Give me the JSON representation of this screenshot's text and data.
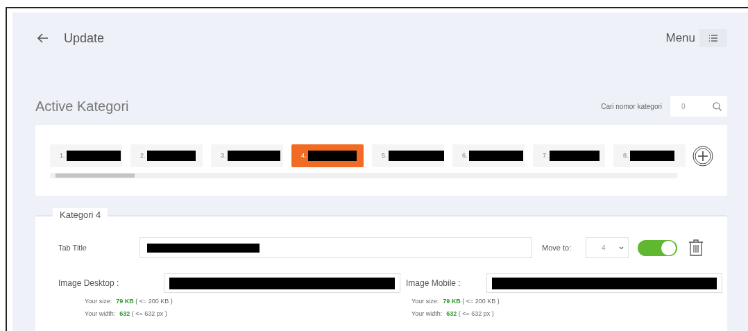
{
  "header": {
    "title": "Update",
    "menu_label": "Menu"
  },
  "section_title": "Active Kategori",
  "search": {
    "label": "Cari nomor kategori",
    "value": "0"
  },
  "category_tabs": [
    {
      "number": "1.",
      "selected": false
    },
    {
      "number": "2.",
      "selected": false
    },
    {
      "number": "3.",
      "selected": false
    },
    {
      "number": "4.",
      "selected": true
    },
    {
      "number": "5.",
      "selected": false
    },
    {
      "number": "6.",
      "selected": false
    },
    {
      "number": "7.",
      "selected": false
    },
    {
      "number": "8.",
      "selected": false
    }
  ],
  "kategori_panel": {
    "legend": "Kategori 4",
    "tab_title_label": "Tab Title",
    "move_to_label": "Move to:",
    "move_to_value": "4",
    "on": true,
    "images": [
      {
        "label": "Image Desktop :",
        "size_label": "Your size:",
        "size_value": "79 KB",
        "size_limit": "( <= 200 KB )",
        "width_label": "Your width:",
        "width_value": "632",
        "width_limit": "( <= 632 px )"
      },
      {
        "label": "Image Mobile :",
        "size_label": "Your size:",
        "size_value": "79 KB",
        "size_limit": "( <= 200 KB )",
        "width_label": "Your width:",
        "width_value": "632",
        "width_limit": "( <= 632 px )"
      }
    ]
  }
}
